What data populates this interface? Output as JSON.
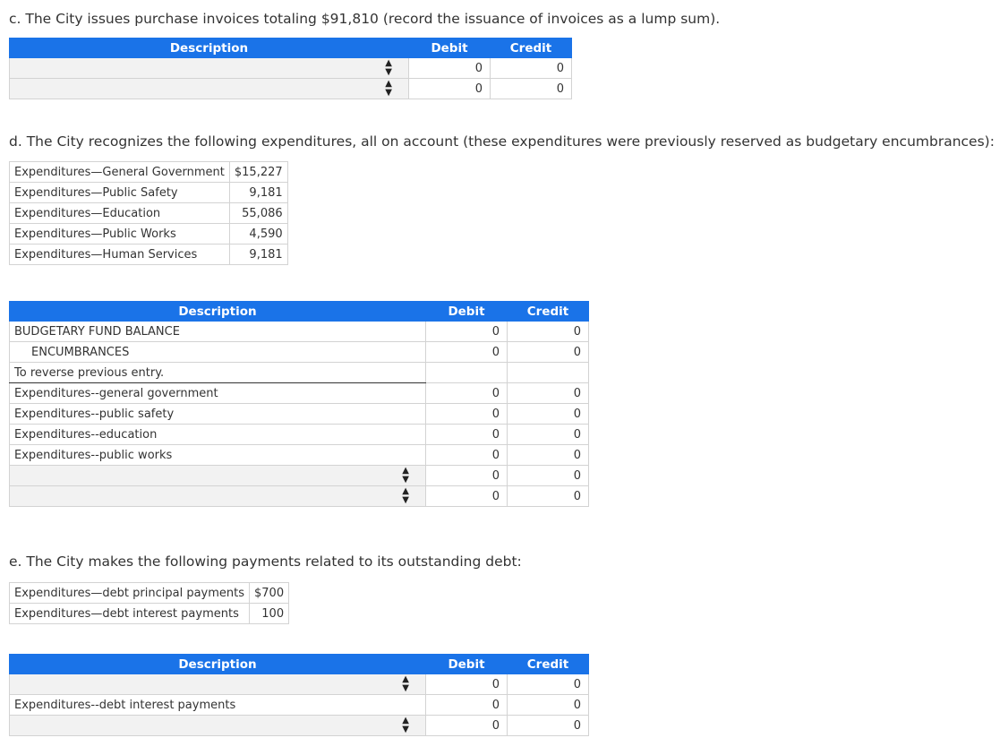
{
  "part_c": {
    "prompt": "c. The City issues purchase invoices totaling $91,810 (record the issuance of invoices as a lump sum).",
    "headers": {
      "description": "Description",
      "debit": "Debit",
      "credit": "Credit"
    },
    "rows": [
      {
        "debit": "0",
        "credit": "0"
      },
      {
        "debit": "0",
        "credit": "0"
      }
    ]
  },
  "part_d": {
    "prompt": "d. The City recognizes the following expenditures, all on account (these expenditures were previously reserved as budgetary encumbrances):",
    "info": [
      {
        "label": "Expenditures—General Government",
        "amount": "$15,227"
      },
      {
        "label": "Expenditures—Public Safety",
        "amount": "9,181"
      },
      {
        "label": "Expenditures—Education",
        "amount": "55,086"
      },
      {
        "label": "Expenditures—Public Works",
        "amount": "4,590"
      },
      {
        "label": "Expenditures—Human Services",
        "amount": "9,181"
      }
    ],
    "headers": {
      "description": "Description",
      "debit": "Debit",
      "credit": "Credit"
    },
    "rows": [
      {
        "description": "BUDGETARY FUND BALANCE",
        "debit": "0",
        "credit": "0"
      },
      {
        "description": "ENCUMBRANCES",
        "debit": "0",
        "credit": "0"
      },
      {
        "description": "To reverse previous entry."
      },
      {
        "description": "Expenditures--general government",
        "debit": "0",
        "credit": "0"
      },
      {
        "description": "Expenditures--public safety",
        "debit": "0",
        "credit": "0"
      },
      {
        "description": "Expenditures--education",
        "debit": "0",
        "credit": "0"
      },
      {
        "description": "Expenditures--public works",
        "debit": "0",
        "credit": "0"
      },
      {
        "description": "",
        "debit": "0",
        "credit": "0"
      },
      {
        "description": "",
        "debit": "0",
        "credit": "0"
      }
    ]
  },
  "part_e": {
    "prompt": "e. The City makes the following payments related to its outstanding debt:",
    "info": [
      {
        "label": "Expenditures—debt principal payments",
        "amount": "$700"
      },
      {
        "label": "Expenditures—debt interest payments",
        "amount": "100"
      }
    ],
    "headers": {
      "description": "Description",
      "debit": "Debit",
      "credit": "Credit"
    },
    "rows": [
      {
        "description": "",
        "debit": "0",
        "credit": "0"
      },
      {
        "description": "Expenditures--debt interest payments",
        "debit": "0",
        "credit": "0"
      },
      {
        "description": "",
        "debit": "0",
        "credit": "0"
      }
    ]
  },
  "icons": {
    "select_arrows": "up-down-arrows-icon"
  }
}
